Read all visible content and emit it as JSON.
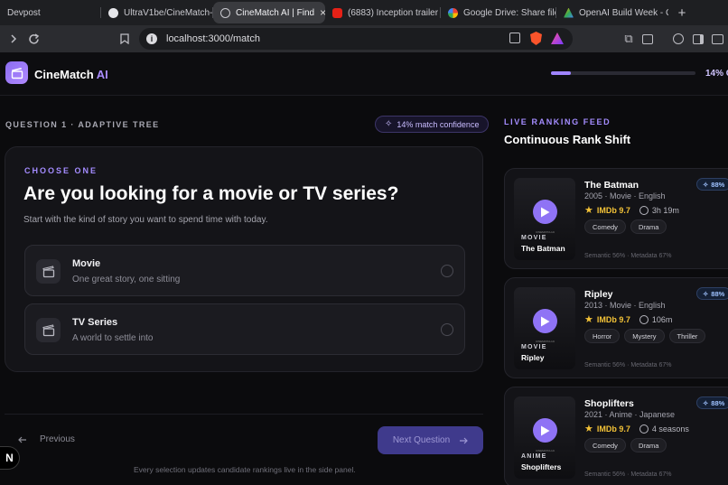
{
  "browser": {
    "tabs": [
      {
        "title": "Devpost",
        "active": false,
        "favicon_color": "#1e1f22"
      },
      {
        "title": "UltraV1be/CineMatch-AI",
        "active": false,
        "favicon_color": "#e6e6ea"
      },
      {
        "title": "CineMatch AI | Find",
        "active": true,
        "favicon_color": "#c9c9cf"
      },
      {
        "title": "(6883) Inception trailer",
        "active": false,
        "favicon_color": "#e62117"
      },
      {
        "title": "Google Drive: Share files",
        "active": false,
        "favicon_color": "#4285f4"
      },
      {
        "title": "OpenAI Build Week - Go",
        "active": false,
        "favicon_color": "#fbbc04"
      }
    ],
    "new_tab_label": "+",
    "close_label": "×",
    "url": "localhost:3000/match"
  },
  "app": {
    "brand_name": "CineMatch",
    "brand_suffix": "AI",
    "progress_fraction": 0.14,
    "progress_label": "14% C"
  },
  "question": {
    "label": "QUESTION 1 · ADAPTIVE TREE",
    "confidence": "14% match confidence",
    "choose_label": "CHOOSE ONE",
    "title": "Are you looking for a movie or TV series?",
    "subtitle": "Start with the kind of story you want to spend time with today.",
    "options": [
      {
        "title": "Movie",
        "description": "One great story, one sitting"
      },
      {
        "title": "TV Series",
        "description": "A world to settle into"
      }
    ],
    "previous_label": "Previous",
    "next_label": "Next Question",
    "footnote": "Every selection updates candidate rankings live in the side panel."
  },
  "feed": {
    "label": "LIVE RANKING FEED",
    "title": "Continuous Rank Shift",
    "poster_caption": "CINEMATCH AI",
    "movies": [
      {
        "title": "The Batman",
        "meta": "2005 · Movie · English",
        "imdb": "IMDb 9.7",
        "duration": "3h 19m",
        "tags": [
          "Comedy",
          "Drama"
        ],
        "score": "Semantic 56% · Metadata 67%",
        "match": "88%",
        "kind": "MOVIE"
      },
      {
        "title": "Ripley",
        "meta": "2013 · Movie · English",
        "imdb": "IMDb 9.7",
        "duration": "106m",
        "tags": [
          "Horror",
          "Mystery",
          "Thriller"
        ],
        "score": "Semantic 56% · Metadata 67%",
        "match": "88%",
        "kind": "MOVIE"
      },
      {
        "title": "Shoplifters",
        "meta": "2021 · Anime · Japanese",
        "imdb": "IMDb 9.7",
        "duration": "4 seasons",
        "tags": [
          "Comedy",
          "Drama"
        ],
        "score": "Semantic 56% · Metadata 67%",
        "match": "88%",
        "kind": "ANIME"
      }
    ]
  },
  "dev_badge": "N"
}
